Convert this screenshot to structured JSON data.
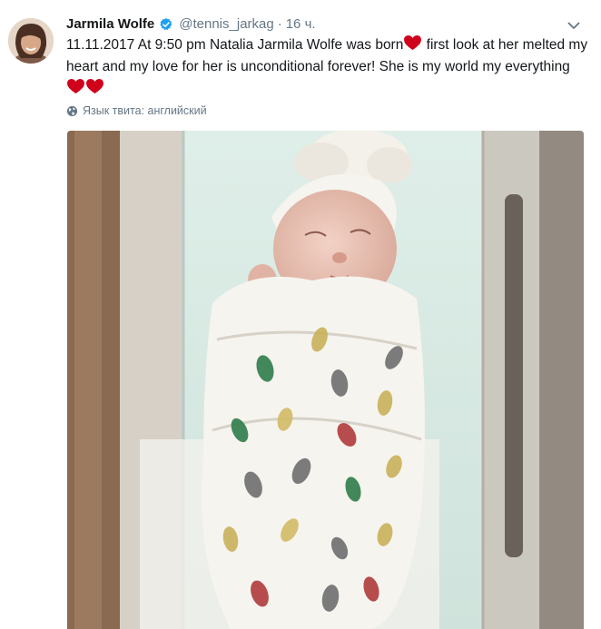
{
  "tweet": {
    "author": {
      "name": "Jarmila Wolfe",
      "handle": "@tennis_jarkag",
      "verified": true
    },
    "separator": "·",
    "time": "16 ч.",
    "text_part1": "11.11.2017 At 9:50 pm Natalia Jarmila Wolfe was born",
    "text_part2": " first look at her melted my heart and my love for her is unconditional forever! She is my world my everything ",
    "language_label": "Язык твита: английский",
    "colors": {
      "verified_badge": "#1da1f2",
      "heart": "#d0021b",
      "secondary_text": "#657786"
    },
    "icons": [
      "verified-icon",
      "chevron-down-icon",
      "heart-emoji",
      "globe-icon"
    ]
  }
}
